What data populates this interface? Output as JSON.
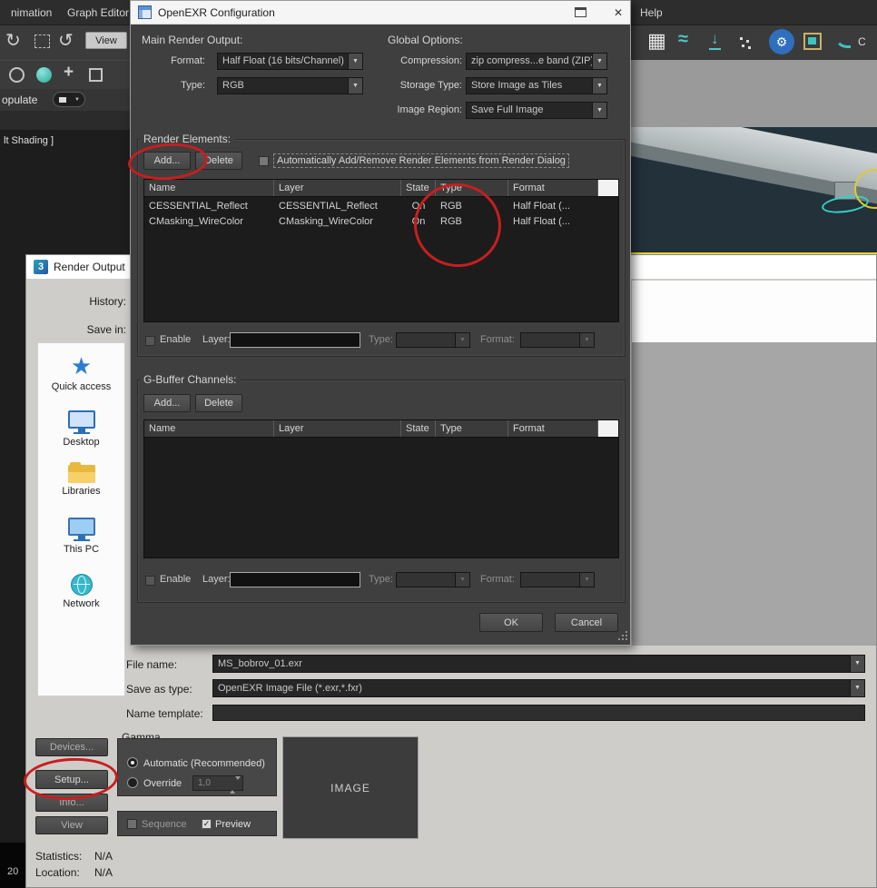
{
  "colors": {
    "annotation_red": "#c81e1e",
    "accent_teal": "#3fc3bd",
    "accent_blue": "#2f6fbf",
    "viewport_yellow": "#e8d23a"
  },
  "icons": {
    "caret_down": "▼",
    "close": "✕",
    "check": "✓",
    "star": "★",
    "gear": "⚙",
    "undo": "↻",
    "redo": "↺",
    "plus": "+",
    "grid": "▦",
    "wave": "≈",
    "down_arrow": "↓",
    "max_logo": "3"
  },
  "background": {
    "menu_animation": "nimation",
    "menu_graph_editors": "Graph Editor",
    "menu_help": "Help",
    "view_button": "View",
    "populate_label": "opulate",
    "shading_label": "lt Shading ]",
    "toolbar_overflow": "C",
    "frame_number": "20"
  },
  "openexr": {
    "title": "OpenEXR Configuration",
    "main_output": {
      "label": "Main Render Output:",
      "format_label": "Format:",
      "format_value": "Half Float (16 bits/Channel)",
      "type_label": "Type:",
      "type_value": "RGB"
    },
    "global_options": {
      "label": "Global Options:",
      "compression_label": "Compression:",
      "compression_value": "zip compress...e band (ZIP)",
      "storage_label": "Storage Type:",
      "storage_value": "Store Image as Tiles",
      "region_label": "Image Region:",
      "region_value": "Save Full Image"
    },
    "render_elements": {
      "label": "Render Elements:",
      "add": "Add...",
      "delete": "Delete",
      "auto_label": "Automatically Add/Remove Render Elements from Render Dialog",
      "columns": [
        "Name",
        "Layer",
        "State",
        "Type",
        "Format"
      ],
      "rows": [
        {
          "name": "CESSENTIAL_Reflect",
          "layer": "CESSENTIAL_Reflect",
          "state": "On",
          "type": "RGB",
          "format": "Half Float (..."
        },
        {
          "name": "CMasking_WireColor",
          "layer": "CMasking_WireColor",
          "state": "On",
          "type": "RGB",
          "format": "Half Float (..."
        }
      ],
      "enable": "Enable",
      "layer_label": "Layer:",
      "type_label": "Type:",
      "format_label": "Format:"
    },
    "gbuffer": {
      "label": "G-Buffer Channels:",
      "add": "Add...",
      "delete": "Delete",
      "columns": [
        "Name",
        "Layer",
        "State",
        "Type",
        "Format"
      ],
      "enable": "Enable",
      "layer_label": "Layer:",
      "type_label": "Type:",
      "format_label": "Format:"
    },
    "ok": "OK",
    "cancel": "Cancel"
  },
  "render_output": {
    "title": "Render Output",
    "history_label": "History:",
    "save_in_label": "Save in:",
    "places": [
      "Quick access",
      "Desktop",
      "Libraries",
      "This PC",
      "Network"
    ],
    "file_name_label": "File name:",
    "file_name_value": "MS_bobrov_01.exr",
    "save_type_label": "Save as type:",
    "save_type_value": "OpenEXR Image File (*.exr,*.fxr)",
    "template_label": "Name template:",
    "gamma_label": "Gamma",
    "gamma_automatic": "Automatic (Recommended)",
    "gamma_override": "Override",
    "gamma_value": "1,0",
    "devices": "Devices...",
    "setup": "Setup...",
    "info": "Info...",
    "view": "View",
    "sequence": "Sequence",
    "preview": "Preview",
    "image_placeholder": "IMAGE",
    "statistics_label": "Statistics:",
    "statistics_value": "N/A",
    "location_label": "Location:",
    "location_value": "N/A"
  }
}
